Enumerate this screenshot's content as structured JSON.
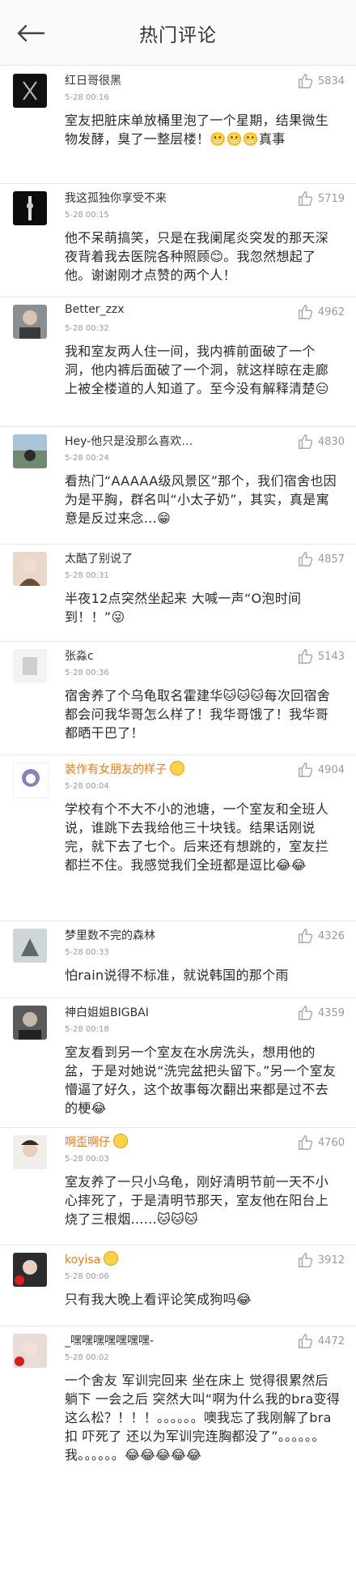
{
  "header": {
    "title": "热门评论"
  },
  "comments": [
    {
      "name": "红日哥很黑",
      "time": "5-28 00:16",
      "likes": "5834",
      "text": "室友把脏床单放桶里泡了一个星期，结果微生物发酵，臭了一整层楼！😬😬😬真事"
    },
    {
      "name": "我这孤独你享受不来",
      "time": "5-28 00:15",
      "likes": "5719",
      "text": "他不呆萌搞笑，只是在我阑尾炎突发的那天深夜背着我去医院各种照顾😊。我忽然想起了他。谢谢刚才点赞的两个人！"
    },
    {
      "name": "Better_zzx",
      "time": "5-28 00:32",
      "likes": "4962",
      "text": "我和室友两人住一间，我内裤前面破了一个洞，他内裤后面破了一个洞，就这样晾在走廊上被全楼道的人知道了。至今没有解释清楚😑"
    },
    {
      "name": "Hey-他只是没那么喜欢…",
      "time": "5-28 00:24",
      "likes": "4830",
      "text": "看热门“AAAAA级风景区”那个，我们宿舍也因为是平胸，群名叫“小太子奶”，其实，真是寓意是反过来念…😁"
    },
    {
      "name": "太酷了别说了",
      "time": "5-28 00:31",
      "likes": "4857",
      "text": "半夜12点突然坐起来 大喊一声“O泡时间到！！”😜"
    },
    {
      "name": "张淼c",
      "time": "5-28 00:36",
      "likes": "5143",
      "text": "宿舍养了个乌龟取名霍建华🐱🐱🐱每次回宿舍都会问我华哥怎么样了！我华哥饿了！我华哥都晒干巴了！"
    },
    {
      "name": "装作有女朋友的样子",
      "time": "5-28 00:04",
      "likes": "4904",
      "text": "学校有个不大不小的池塘，一个室友和全班人说，谁跳下去我给他三十块钱。结果话刚说完，就下去了七个。后来还有想跳的，室友拦都拦不住。我感觉我们全班都是逗比😂😂"
    },
    {
      "name": "梦里数不完的森林",
      "time": "5-28 00:33",
      "likes": "4326",
      "text": "怕rain说得不标准，就说韩国的那个雨"
    },
    {
      "name": "神白姐姐BIGBAI",
      "time": "5-28 00:18",
      "likes": "4359",
      "text": "室友看到另一个室友在水房洗头，想用他的盆，于是对她说“洗完盆把头留下。”另一个室友懵逼了好久，这个故事每次翻出来都是过不去的梗😂"
    },
    {
      "name": "啊歪啊仔",
      "time": "5-28 00:03",
      "likes": "4760",
      "text": "室友养了一只小乌龟，刚好清明节前一天不小心摔死了，于是清明节那天，室友他在阳台上烧了三根烟……🐱🐱🐱"
    },
    {
      "name": "koyisa",
      "time": "5-28 00:06",
      "likes": "3912",
      "text": "只有我大晚上看评论笑成狗吗😂"
    },
    {
      "name": "_嘿嘿嘿嘿嘿嘿嘿-",
      "time": "5-28 00:02",
      "likes": "4472",
      "text": "一个舍友 军训完回来 坐在床上 觉得很累然后躺下 一会之后 突然大叫“啊为什么我的bra变得这么松？！！！。。。。。。噢我忘了我刚解了bra扣 吓死了 还以为军训完连胸都没了”。。。。。。我。。。。。。😂😂😂😂😂"
    }
  ],
  "colors": {
    "orange_name": "#ee7b13",
    "text": "#2a2a2a",
    "meta": "#9a9a9a"
  }
}
